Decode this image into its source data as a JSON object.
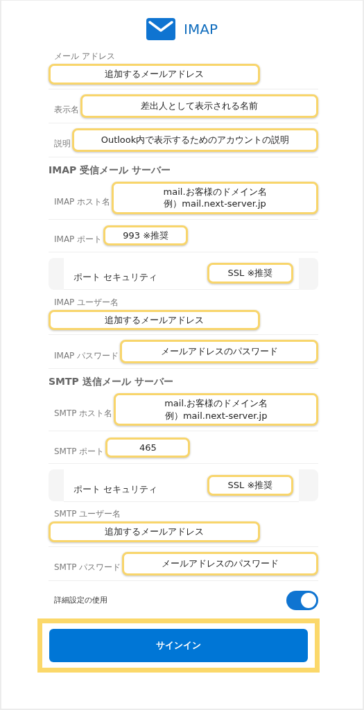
{
  "header": {
    "title": "IMAP"
  },
  "rows": [
    {
      "kind": "stacked",
      "label": "メール アドレス",
      "value": [
        "追加するメールアドレス"
      ]
    },
    {
      "kind": "inline",
      "label": "表示名",
      "value": [
        "差出人として表示される名前"
      ]
    },
    {
      "kind": "inline",
      "label": "説明",
      "value": [
        "Outlook内で表示するためのアカウントの説明"
      ]
    },
    {
      "kind": "section",
      "label": "IMAP 受信メール サーバー"
    },
    {
      "kind": "inline",
      "label": "IMAP ホスト名",
      "value": [
        "mail.お客様のドメイン名",
        "例）mail.next-server.jp"
      ]
    },
    {
      "kind": "inline",
      "label": "IMAP ポート",
      "value": [
        "993 ※推奨"
      ]
    },
    {
      "kind": "security",
      "label": "ポート セキュリティ",
      "value": [
        "SSL ※推奨"
      ]
    },
    {
      "kind": "stacked",
      "label": "IMAP ユーザー名",
      "value": [
        "追加するメールアドレス"
      ]
    },
    {
      "kind": "inline",
      "label": "IMAP パスワード",
      "value": [
        "メールアドレスのパスワード"
      ]
    },
    {
      "kind": "section",
      "label": "SMTP 送信メール サーバー"
    },
    {
      "kind": "inline",
      "label": "SMTP ホスト名",
      "value": [
        "mail.お客様のドメイン名",
        "例）mail.next-server.jp"
      ]
    },
    {
      "kind": "inline",
      "label": "SMTP ポート",
      "value": [
        "465"
      ]
    },
    {
      "kind": "security",
      "label": "ポート セキュリティ",
      "value": [
        "SSL ※推奨"
      ]
    },
    {
      "kind": "stacked",
      "label": "SMTP ユーザー名",
      "value": [
        "追加するメールアドレス"
      ]
    },
    {
      "kind": "inline",
      "label": "SMTP パスワード",
      "value": [
        "メールアドレスのパスワード"
      ]
    }
  ],
  "advanced": {
    "label": "詳細設定の使用",
    "on": true
  },
  "signin": {
    "label": "サインイン"
  }
}
